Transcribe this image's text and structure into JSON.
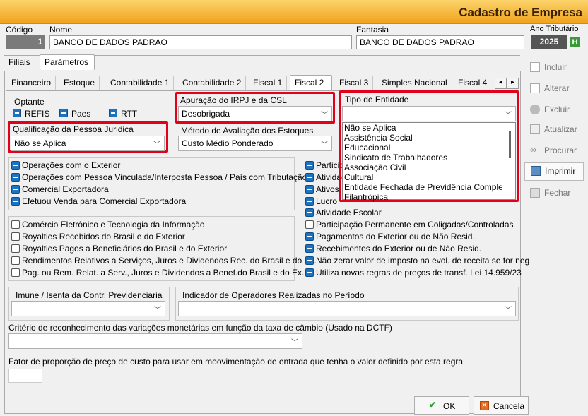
{
  "window": {
    "title": "Cadastro de Empresa"
  },
  "header": {
    "codigo_label": "Código",
    "codigo_value": "1",
    "nome_label": "Nome",
    "nome_value": "BANCO DE DADOS PADRAO",
    "fantasia_label": "Fantasia",
    "fantasia_value": "BANCO DE DADOS PADRAO",
    "ano_label": "Ano Tributário",
    "ano_value": "2025",
    "ano_button": "H"
  },
  "main_tabs": [
    "Filiais",
    "Parâmetros"
  ],
  "sub_tabs": [
    "Financeiro",
    "Estoque",
    "Contabilidade 1",
    "Contabilidade 2",
    "Fiscal 1",
    "Fiscal 2",
    "Fiscal 3",
    "Simples Nacional",
    "Fiscal 4"
  ],
  "scroll_arrows": [
    "◂",
    "▸"
  ],
  "optante": {
    "label": "Optante",
    "items": [
      {
        "label": "REFIS",
        "checked": true
      },
      {
        "label": "Paes",
        "checked": true
      },
      {
        "label": "RTT",
        "checked": true
      }
    ]
  },
  "qualificacao": {
    "label": "Qualificação da Pessoa Juridica",
    "value": "Não se Aplica"
  },
  "apuracao": {
    "label": "Apuração do IRPJ e da CSL",
    "value": "Desobrigada"
  },
  "metodo": {
    "label": "Método de Avaliação dos Estoques",
    "value": "Custo Médio Ponderado"
  },
  "tipo_entidade": {
    "label": "Tipo de Entidade",
    "value": "",
    "options": [
      "Não se Aplica",
      "Assistência Social",
      "Educacional",
      "Sindicato de Trabalhadores",
      "Associação Civil",
      "Cultural",
      "Entidade Fechada de Previdência Compleme",
      "Filantrópica"
    ]
  },
  "checks_a": [
    {
      "label": "Operações com o Exterior",
      "checked": true
    },
    {
      "label": "Operações com Pessoa Vinculada/Interposta Pessoa / País com Tributação",
      "checked": true
    },
    {
      "label": "Comercial Exportadora",
      "checked": true
    },
    {
      "label": "Efetuou Venda para Comercial Exportadora",
      "checked": true
    }
  ],
  "checks_b": [
    {
      "label": "Participa",
      "checked": true
    },
    {
      "label": "Atividad",
      "checked": true
    },
    {
      "label": "Ativos",
      "checked": true
    },
    {
      "label": "Lucro",
      "checked": true
    }
  ],
  "checks_c": [
    {
      "label": "Comércio Eletrônico e Tecnologia da Informação",
      "checked": false
    },
    {
      "label": "Royalties Recebidos do Brasil e do Exterior",
      "checked": false
    },
    {
      "label": "Royalties Pagos a Beneficiários do Brasil e do Exterior",
      "checked": false
    },
    {
      "label": "Rendimentos Relativos a Serviços, Juros e Dividendos Rec. do Brasil e do Ex.",
      "checked": false
    },
    {
      "label": "Pag. ou Rem.  Relat. a Serv., Juros e Dividendos a Benef.do Brasil e do Ex.",
      "checked": false
    }
  ],
  "checks_d": [
    {
      "label": "Atividade Escolar",
      "checked": true
    },
    {
      "label": "Participação Permanente em Coligadas/Controladas",
      "checked": false
    },
    {
      "label": "Pagamentos do Exterior ou de Não Resid.",
      "checked": true
    },
    {
      "label": "Recebimentos do Exterior ou de Não Resid.",
      "checked": true
    },
    {
      "label": "Não zerar valor de imposto na evol. de receita se for neg",
      "checked": true
    },
    {
      "label": "Utiliza novas regras de preços de transf.  Lei 14.959/23",
      "checked": true
    }
  ],
  "imune": {
    "label": "Imune / Isenta da Contr. Previdenciaria",
    "value": ""
  },
  "indicador": {
    "label": "Indicador de Operadores Realizadas no Período",
    "value": ""
  },
  "criterio": {
    "label": "Critério de reconhecimento das variações monetárias em função da taxa de câmbio  (Usado na DCTF)",
    "value": ""
  },
  "fator": {
    "label": "Fator de proporção de preço de custo para usar em moovimentação de entrada que tenha o valor definido por esta regra",
    "value": ""
  },
  "side_buttons": [
    {
      "label": "Incluir",
      "icon": "new-document-icon",
      "enabled": false
    },
    {
      "label": "Alterar",
      "icon": "edit-icon",
      "enabled": false
    },
    {
      "label": "Excluir",
      "icon": "delete-icon",
      "enabled": false
    },
    {
      "label": "Atualizar",
      "icon": "refresh-icon",
      "enabled": false
    },
    {
      "label": "Procurar",
      "icon": "binoculars-icon",
      "enabled": false
    },
    {
      "label": "Imprimir",
      "icon": "printer-icon",
      "enabled": true
    },
    {
      "label": "Fechar",
      "icon": "close-folder-icon",
      "enabled": false
    }
  ],
  "footer": {
    "ok": "OK",
    "cancel": "Cancela"
  },
  "colors": {
    "highlight": "#e3001b",
    "title_bar": "#f1a21c",
    "checkbox": "#1e73be"
  }
}
